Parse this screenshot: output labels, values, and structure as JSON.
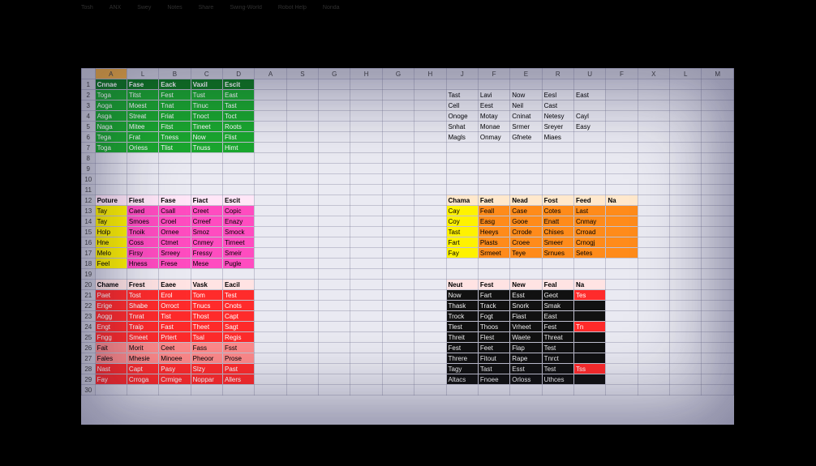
{
  "sheet": {
    "columns": [
      "",
      "A",
      "L",
      "B",
      "C",
      "D",
      "A",
      "S",
      "G",
      "H",
      "G",
      "H",
      "J",
      "F",
      "E",
      "R",
      "U",
      "F",
      "X",
      "L",
      "M"
    ],
    "selected_col_index": 1,
    "selected_row_index": 1
  },
  "table_green": {
    "row": 1,
    "col": 1,
    "header_class": "c-green-h",
    "body_class": "c-green",
    "headers": [
      "Cnnae",
      "Fase",
      "Eack",
      "Vaxil",
      "Escit"
    ],
    "rows": [
      [
        "Toga",
        "Titst",
        "Fest",
        "Tust",
        "East"
      ],
      [
        "Aoga",
        "Moest",
        "Tnat",
        "Tinuc",
        "Tast"
      ],
      [
        "Asga",
        "Streat",
        "Friat",
        "Tnoct",
        "Toct"
      ],
      [
        "Naga",
        "Mitee",
        "Fitst",
        "Tineet",
        "Roots"
      ],
      [
        "Tega",
        "Frat",
        "Tness",
        "Now",
        "Flist"
      ],
      [
        "Toga",
        "Oriess",
        "Tlist",
        "Tnuss",
        "Himt"
      ]
    ]
  },
  "table_right_top": {
    "row": 2,
    "col": 12,
    "header_class": "c-plain-h",
    "body_class": "c-plain",
    "headers": [],
    "rows": [
      [
        "Tast",
        "Lavi",
        "Now",
        "Eesl",
        "East"
      ],
      [
        "Cell",
        "Eest",
        "Neil",
        "Cast",
        ""
      ],
      [
        "Onoge",
        "Motay",
        "Cninat",
        "Netesy",
        "Cayl"
      ],
      [
        "Snhat",
        "Monae",
        "Srmer",
        "Sreyer",
        "Easy"
      ],
      [
        "Magls",
        "Onmay",
        "Gfnete",
        "Miaes",
        ""
      ]
    ]
  },
  "table_pink": {
    "row": 12,
    "col": 1,
    "header_class": "c-pink-h",
    "body_class": "c-pink",
    "first_col_class": "c-yellow",
    "headers": [
      "Poture",
      "Fiest",
      "Fase",
      "Fiact",
      "Escit"
    ],
    "rows": [
      [
        "Tay",
        "Caed",
        "Csall",
        "Creet",
        "Copic"
      ],
      [
        "Tay",
        "Smoes",
        "Croel",
        "Crreef",
        "Enazy"
      ],
      [
        "Holp",
        "Tnoik",
        "Ornee",
        "Smoz",
        "Smock"
      ],
      [
        "Hne",
        "Coss",
        "Ctmet",
        "Cnmey",
        "Tirneet"
      ],
      [
        "Melo",
        "Firsy",
        "Srreey",
        "Fressy",
        "Smeir"
      ],
      [
        "Feel",
        "Hness",
        "Frese",
        "Mese",
        "Pugle"
      ]
    ]
  },
  "table_orange": {
    "row": 12,
    "col": 12,
    "header_class": "c-orange-h",
    "body_class": "c-orange",
    "first_col_class": "c-orange-y",
    "headers": [
      "Chama",
      "Faet",
      "Nead",
      "Fost",
      "Feed",
      "Na"
    ],
    "rows": [
      [
        "Cay",
        "Feall",
        "Case",
        "Cotes",
        "Last",
        ""
      ],
      [
        "Coy",
        "Easg",
        "Gooe",
        "Enatt",
        "Cnmay",
        ""
      ],
      [
        "Tast",
        "Heeys",
        "Crrode",
        "Chises",
        "Crroad",
        ""
      ],
      [
        "Fart",
        "Plasts",
        "Croee",
        "Smeer",
        "Crnogj",
        ""
      ],
      [
        "Fay",
        "Srmeet",
        "Teye",
        "Srnues",
        "Setes",
        ""
      ]
    ]
  },
  "table_red": {
    "row": 20,
    "col": 1,
    "header_class": "c-red-h",
    "body_class": "c-red",
    "alt_rows_class": "c-redlt",
    "headers": [
      "Chame",
      "Frest",
      "Eaee",
      "Vask",
      "Eacil"
    ],
    "rows": [
      [
        "Paet",
        "Tost",
        "Erol",
        "Tom",
        "Test"
      ],
      [
        "Erige",
        "Shabe",
        "Orroct",
        "Tnucs",
        "Cnots"
      ],
      [
        "Aogg",
        "Tnrat",
        "Tist",
        "Thost",
        "Capt"
      ],
      [
        "Engt",
        "Traip",
        "Fast",
        "Theet",
        "Sagt"
      ],
      [
        "Fngg",
        "Smeet",
        "Prtert",
        "Tsal",
        "Regis"
      ],
      [
        "Fait",
        "Morit",
        "Ceet",
        "Fass",
        "Fsst"
      ],
      [
        "Fales",
        "Mhesie",
        "Minoee",
        "Pheoor",
        "Prose"
      ],
      [
        "Nast",
        "Capt",
        "Pasy",
        "Slzy",
        "Past"
      ],
      [
        "Fay",
        "Crroga",
        "Crmige",
        "Noppar",
        "Allers"
      ]
    ]
  },
  "table_black": {
    "row": 20,
    "col": 12,
    "header_class": "c-black-h",
    "body_class": "c-black",
    "badge_class": "c-red",
    "headers": [
      "Neut",
      "Fest",
      "New",
      "Feal",
      "Na"
    ],
    "rows": [
      [
        "Now",
        "Fart",
        "Esst",
        "Geot",
        "Tes"
      ],
      [
        "Thask",
        "Track",
        "Snork",
        "Smak",
        ""
      ],
      [
        "Trock",
        "Fogt",
        "Flast",
        "East",
        ""
      ],
      [
        "Tlest",
        "Thoos",
        "Vrheet",
        "Fest",
        "Tn"
      ],
      [
        "Threit",
        "Flest",
        "Waete",
        "Threat",
        ""
      ],
      [
        "Fest",
        "Feet",
        "Flap",
        "Test",
        ""
      ],
      [
        "Threre",
        "Fitout",
        "Rape",
        "Tnrct",
        ""
      ],
      [
        "Tagy",
        "Tast",
        "Esst",
        "Test",
        "Tss"
      ],
      [
        "Altacs",
        "Fnoee",
        "Orloss",
        "Uthces",
        ""
      ]
    ]
  },
  "taskbar": {
    "items": [
      "Tosh",
      "ANX",
      "Swey",
      "Notes",
      "Share",
      "Swing-World",
      "Robot Help",
      "Nonda"
    ]
  },
  "row_count": 30
}
